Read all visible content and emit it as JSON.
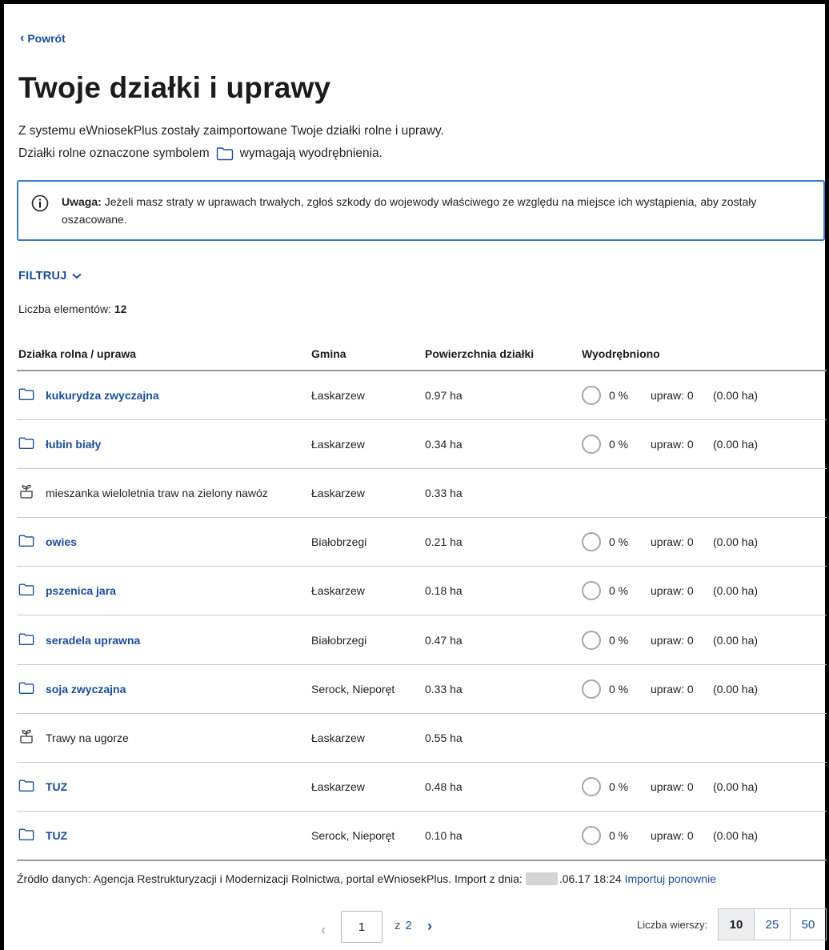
{
  "nav": {
    "back_label": "Powrót"
  },
  "page": {
    "title": "Twoje działki i uprawy",
    "intro_line1": "Z systemu eWniosekPlus zostały zaimportowane Twoje działki rolne i uprawy.",
    "intro_line2_before": "Działki rolne oznaczone symbolem",
    "intro_line2_after": "wymagają wyodrębnienia."
  },
  "alert": {
    "label": "Uwaga:",
    "text": "Jeżeli masz straty w uprawach trwałych, zgłoś szkody do wojewody właściwego ze względu na miejsce ich wystąpienia, aby zostały oszacowane."
  },
  "filter": {
    "label": "FILTRUJ"
  },
  "count": {
    "label": "Liczba elementów:",
    "value": "12"
  },
  "table": {
    "headers": [
      "Działka rolna / uprawa",
      "Gmina",
      "Powierzchnia działki",
      "Wyodrębniono"
    ],
    "rows": [
      {
        "icon": "folder-icon",
        "name": "kukurydza zwyczajna",
        "gmina": "Łaskarzew",
        "area": "0.97 ha",
        "pct": "0 %",
        "upraw": "upraw: 0",
        "ha": "(0.00 ha)"
      },
      {
        "icon": "folder-icon",
        "name": "łubin biały",
        "gmina": "Łaskarzew",
        "area": "0.34 ha",
        "pct": "0 %",
        "upraw": "upraw: 0",
        "ha": "(0.00 ha)"
      },
      {
        "icon": "plant-icon",
        "name": "mieszanka wieloletnia traw na zielony nawóz",
        "gmina": "Łaskarzew",
        "area": "0.33 ha"
      },
      {
        "icon": "folder-icon",
        "name": "owies",
        "gmina": "Białobrzegi",
        "area": "0.21 ha",
        "pct": "0 %",
        "upraw": "upraw: 0",
        "ha": "(0.00 ha)"
      },
      {
        "icon": "folder-icon",
        "name": "pszenica jara",
        "gmina": "Łaskarzew",
        "area": "0.18 ha",
        "pct": "0 %",
        "upraw": "upraw: 0",
        "ha": "(0.00 ha)"
      },
      {
        "icon": "folder-icon",
        "name": "seradela uprawna",
        "gmina": "Białobrzegi",
        "area": "0.47 ha",
        "pct": "0 %",
        "upraw": "upraw: 0",
        "ha": "(0.00 ha)"
      },
      {
        "icon": "folder-icon",
        "name": "soja zwyczajna",
        "gmina": "Serock, Nieporęt",
        "area": "0.33 ha",
        "pct": "0 %",
        "upraw": "upraw: 0",
        "ha": "(0.00 ha)"
      },
      {
        "icon": "plant-icon",
        "name": "Trawy na ugorze",
        "gmina": "Łaskarzew",
        "area": "0.55 ha"
      },
      {
        "icon": "folder-icon",
        "name": "TUZ",
        "gmina": "Łaskarzew",
        "area": "0.48 ha",
        "pct": "0 %",
        "upraw": "upraw: 0",
        "ha": "(0.00 ha)"
      },
      {
        "icon": "folder-icon",
        "name": "TUZ",
        "gmina": "Serock, Nieporęt",
        "area": "0.10 ha",
        "pct": "0 %",
        "upraw": "upraw: 0",
        "ha": "(0.00 ha)"
      }
    ]
  },
  "source": {
    "text": "Źródło danych: Agencja Restrukturyzacji i Modernizacji Rolnictwa, portal eWniosekPlus. Import z dnia:",
    "date_visible": ".06.17 18:24",
    "reimport_label": "Importuj ponownie"
  },
  "pagination": {
    "current_page": "1",
    "of_label": "z",
    "total_pages": "2",
    "rows_label": "Liczba wierszy:",
    "rows_options": [
      "10",
      "25",
      "50"
    ],
    "rows_selected": "10"
  },
  "colors": {
    "link": "#1a4c99",
    "alert_border": "#3a7bc8"
  }
}
